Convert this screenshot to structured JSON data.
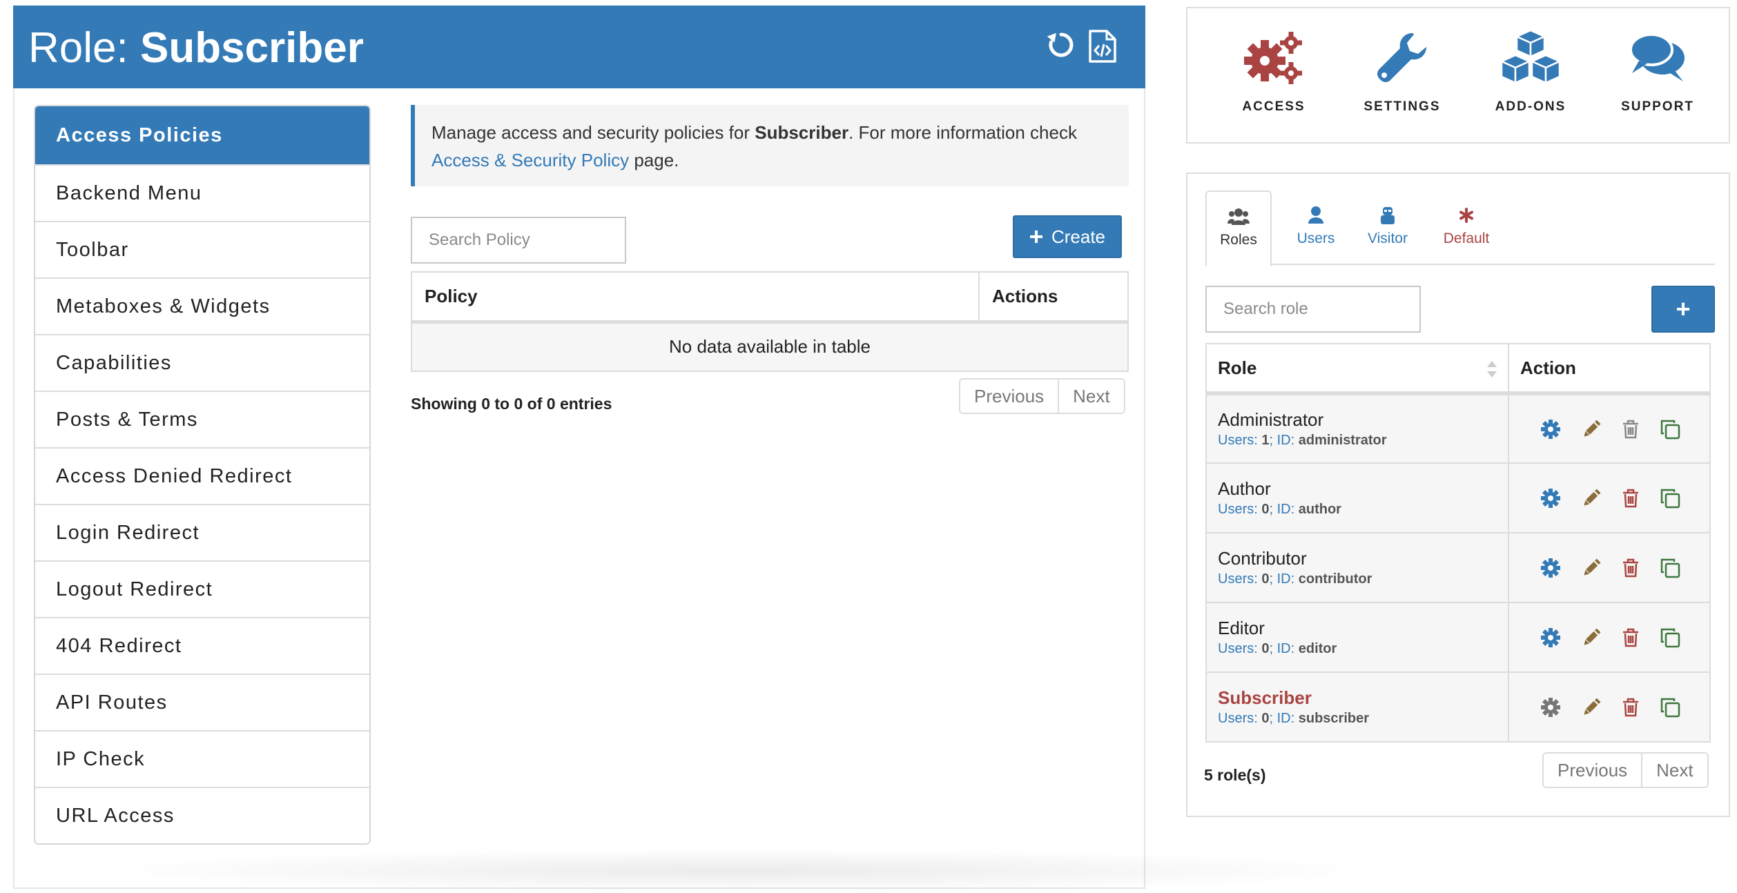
{
  "header": {
    "title_prefix": "Role:",
    "title_role": "Subscriber",
    "reset_icon": "reset-icon",
    "export_icon": "code-file-icon"
  },
  "sidebar": {
    "items": [
      {
        "label": "Access Policies",
        "active": true
      },
      {
        "label": "Backend Menu"
      },
      {
        "label": "Toolbar"
      },
      {
        "label": "Metaboxes & Widgets"
      },
      {
        "label": "Capabilities"
      },
      {
        "label": "Posts & Terms"
      },
      {
        "label": "Access Denied Redirect"
      },
      {
        "label": "Login Redirect"
      },
      {
        "label": "Logout Redirect"
      },
      {
        "label": "404 Redirect"
      },
      {
        "label": "API Routes"
      },
      {
        "label": "IP Check"
      },
      {
        "label": "URL Access"
      }
    ]
  },
  "info": {
    "text_before": "Manage access and security policies for ",
    "role": "Subscriber",
    "text_after": ". For more information check",
    "link": "Access & Security Policy",
    "text_end": " page."
  },
  "policy": {
    "search_placeholder": "Search Policy",
    "create_label": "Create",
    "columns": [
      "Policy",
      "Actions"
    ],
    "empty": "No data available in table",
    "showing": "Showing 0 to 0 of 0 entries",
    "prev": "Previous",
    "next": "Next"
  },
  "tools": [
    {
      "label": "ACCESS",
      "icon": "gears-icon"
    },
    {
      "label": "SETTINGS",
      "icon": "wrench-icon"
    },
    {
      "label": "ADD-ONS",
      "icon": "cubes-icon"
    },
    {
      "label": "SUPPORT",
      "icon": "chat-bubbles-icon"
    }
  ],
  "tabs": [
    {
      "label": "Roles",
      "icon": "users-group-icon",
      "active": true
    },
    {
      "label": "Users",
      "icon": "user-icon"
    },
    {
      "label": "Visitor",
      "icon": "visitor-icon"
    },
    {
      "label": "Default",
      "icon": "asterisk-icon"
    }
  ],
  "roles": {
    "search_placeholder": "Search role",
    "add_label": "+",
    "columns": [
      "Role",
      "Action"
    ],
    "rows": [
      {
        "name": "Administrator",
        "users_label": "Users:",
        "users": "1",
        "id_label": "ID:",
        "id": "administrator"
      },
      {
        "name": "Author",
        "users_label": "Users:",
        "users": "0",
        "id_label": "ID:",
        "id": "author"
      },
      {
        "name": "Contributor",
        "users_label": "Users:",
        "users": "0",
        "id_label": "ID:",
        "id": "contributor"
      },
      {
        "name": "Editor",
        "users_label": "Users:",
        "users": "0",
        "id_label": "ID:",
        "id": "editor"
      },
      {
        "name": "Subscriber",
        "users_label": "Users:",
        "users": "0",
        "id_label": "ID:",
        "id": "subscriber",
        "current": true
      }
    ],
    "count": "5 role(s)",
    "prev": "Previous",
    "next": "Next"
  },
  "colors": {
    "primary": "#337ab7",
    "danger": "#a94442",
    "edit": "#8a6d3b",
    "success": "#3c763d"
  }
}
